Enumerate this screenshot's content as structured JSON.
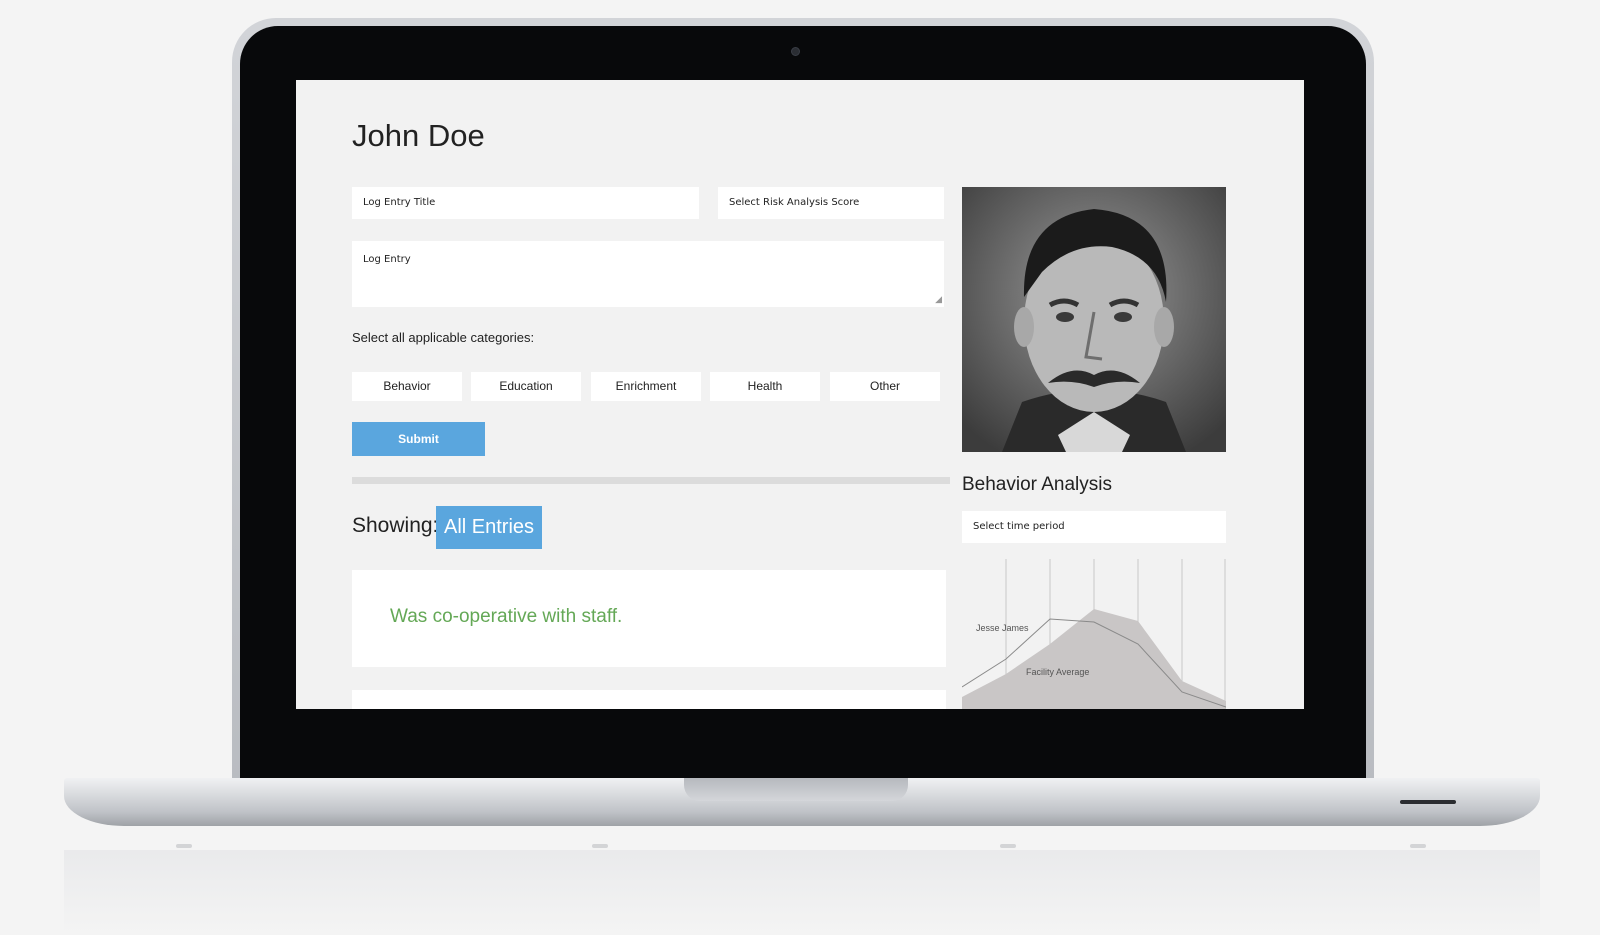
{
  "page": {
    "title": "John Doe"
  },
  "form": {
    "log_title_placeholder": "Log Entry Title",
    "risk_score_placeholder": "Select Risk Analysis Score",
    "log_entry_placeholder": "Log Entry",
    "categories_label": "Select all applicable categories:",
    "categories": [
      "Behavior",
      "Education",
      "Enrichment",
      "Health",
      "Other"
    ],
    "submit_label": "Submit"
  },
  "entries": {
    "showing_label": "Showing:",
    "filter_value": "All Entries",
    "items": [
      {
        "text": "Was co-operative with staff."
      },
      {
        "text": ""
      }
    ]
  },
  "sidebar": {
    "title": "Behavior Analysis",
    "time_period_placeholder": "Select time period",
    "chart_labels": {
      "subject": "Jesse James",
      "average": "Facility Average"
    }
  },
  "colors": {
    "accent": "#5aa6de",
    "entry_text": "#64a856"
  }
}
